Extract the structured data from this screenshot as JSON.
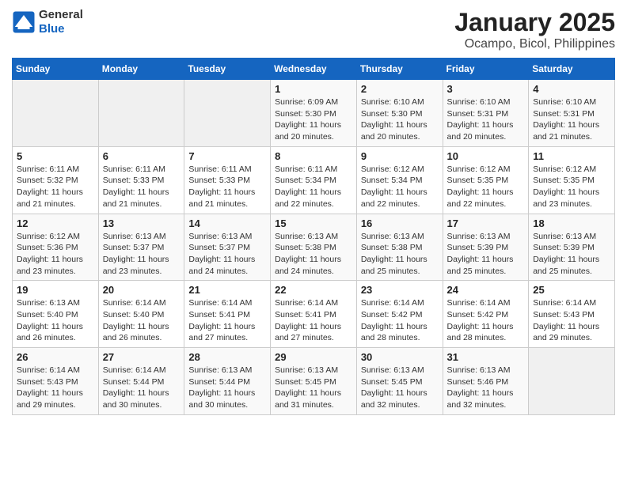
{
  "logo": {
    "general": "General",
    "blue": "Blue"
  },
  "title": "January 2025",
  "subtitle": "Ocampo, Bicol, Philippines",
  "weekdays": [
    "Sunday",
    "Monday",
    "Tuesday",
    "Wednesday",
    "Thursday",
    "Friday",
    "Saturday"
  ],
  "weeks": [
    [
      {
        "day": "",
        "info": ""
      },
      {
        "day": "",
        "info": ""
      },
      {
        "day": "",
        "info": ""
      },
      {
        "day": "1",
        "sunrise": "6:09 AM",
        "sunset": "5:30 PM",
        "daylight": "11 hours and 20 minutes."
      },
      {
        "day": "2",
        "sunrise": "6:10 AM",
        "sunset": "5:30 PM",
        "daylight": "11 hours and 20 minutes."
      },
      {
        "day": "3",
        "sunrise": "6:10 AM",
        "sunset": "5:31 PM",
        "daylight": "11 hours and 20 minutes."
      },
      {
        "day": "4",
        "sunrise": "6:10 AM",
        "sunset": "5:31 PM",
        "daylight": "11 hours and 21 minutes."
      }
    ],
    [
      {
        "day": "5",
        "sunrise": "6:11 AM",
        "sunset": "5:32 PM",
        "daylight": "11 hours and 21 minutes."
      },
      {
        "day": "6",
        "sunrise": "6:11 AM",
        "sunset": "5:33 PM",
        "daylight": "11 hours and 21 minutes."
      },
      {
        "day": "7",
        "sunrise": "6:11 AM",
        "sunset": "5:33 PM",
        "daylight": "11 hours and 21 minutes."
      },
      {
        "day": "8",
        "sunrise": "6:11 AM",
        "sunset": "5:34 PM",
        "daylight": "11 hours and 22 minutes."
      },
      {
        "day": "9",
        "sunrise": "6:12 AM",
        "sunset": "5:34 PM",
        "daylight": "11 hours and 22 minutes."
      },
      {
        "day": "10",
        "sunrise": "6:12 AM",
        "sunset": "5:35 PM",
        "daylight": "11 hours and 22 minutes."
      },
      {
        "day": "11",
        "sunrise": "6:12 AM",
        "sunset": "5:35 PM",
        "daylight": "11 hours and 23 minutes."
      }
    ],
    [
      {
        "day": "12",
        "sunrise": "6:12 AM",
        "sunset": "5:36 PM",
        "daylight": "11 hours and 23 minutes."
      },
      {
        "day": "13",
        "sunrise": "6:13 AM",
        "sunset": "5:37 PM",
        "daylight": "11 hours and 23 minutes."
      },
      {
        "day": "14",
        "sunrise": "6:13 AM",
        "sunset": "5:37 PM",
        "daylight": "11 hours and 24 minutes."
      },
      {
        "day": "15",
        "sunrise": "6:13 AM",
        "sunset": "5:38 PM",
        "daylight": "11 hours and 24 minutes."
      },
      {
        "day": "16",
        "sunrise": "6:13 AM",
        "sunset": "5:38 PM",
        "daylight": "11 hours and 25 minutes."
      },
      {
        "day": "17",
        "sunrise": "6:13 AM",
        "sunset": "5:39 PM",
        "daylight": "11 hours and 25 minutes."
      },
      {
        "day": "18",
        "sunrise": "6:13 AM",
        "sunset": "5:39 PM",
        "daylight": "11 hours and 25 minutes."
      }
    ],
    [
      {
        "day": "19",
        "sunrise": "6:13 AM",
        "sunset": "5:40 PM",
        "daylight": "11 hours and 26 minutes."
      },
      {
        "day": "20",
        "sunrise": "6:14 AM",
        "sunset": "5:40 PM",
        "daylight": "11 hours and 26 minutes."
      },
      {
        "day": "21",
        "sunrise": "6:14 AM",
        "sunset": "5:41 PM",
        "daylight": "11 hours and 27 minutes."
      },
      {
        "day": "22",
        "sunrise": "6:14 AM",
        "sunset": "5:41 PM",
        "daylight": "11 hours and 27 minutes."
      },
      {
        "day": "23",
        "sunrise": "6:14 AM",
        "sunset": "5:42 PM",
        "daylight": "11 hours and 28 minutes."
      },
      {
        "day": "24",
        "sunrise": "6:14 AM",
        "sunset": "5:42 PM",
        "daylight": "11 hours and 28 minutes."
      },
      {
        "day": "25",
        "sunrise": "6:14 AM",
        "sunset": "5:43 PM",
        "daylight": "11 hours and 29 minutes."
      }
    ],
    [
      {
        "day": "26",
        "sunrise": "6:14 AM",
        "sunset": "5:43 PM",
        "daylight": "11 hours and 29 minutes."
      },
      {
        "day": "27",
        "sunrise": "6:14 AM",
        "sunset": "5:44 PM",
        "daylight": "11 hours and 30 minutes."
      },
      {
        "day": "28",
        "sunrise": "6:13 AM",
        "sunset": "5:44 PM",
        "daylight": "11 hours and 30 minutes."
      },
      {
        "day": "29",
        "sunrise": "6:13 AM",
        "sunset": "5:45 PM",
        "daylight": "11 hours and 31 minutes."
      },
      {
        "day": "30",
        "sunrise": "6:13 AM",
        "sunset": "5:45 PM",
        "daylight": "11 hours and 32 minutes."
      },
      {
        "day": "31",
        "sunrise": "6:13 AM",
        "sunset": "5:46 PM",
        "daylight": "11 hours and 32 minutes."
      },
      {
        "day": "",
        "info": ""
      }
    ]
  ]
}
